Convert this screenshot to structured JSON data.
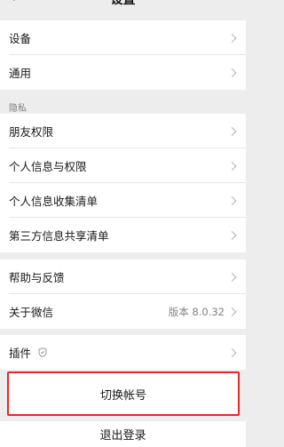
{
  "header": {
    "title": "设置",
    "back_icon": "chevron-left-icon"
  },
  "group1": {
    "items": [
      {
        "label": "设备"
      },
      {
        "label": "通用"
      }
    ]
  },
  "privacy": {
    "section_label": "隐私",
    "items": [
      {
        "label": "朋友权限"
      },
      {
        "label": "个人信息与权限"
      },
      {
        "label": "个人信息收集清单"
      },
      {
        "label": "第三方信息共享清单"
      }
    ]
  },
  "group3": {
    "items": [
      {
        "label": "帮助与反馈"
      },
      {
        "label": "关于微信",
        "value": "版本 8.0.32"
      }
    ]
  },
  "group4": {
    "items": [
      {
        "label": "插件",
        "icon": "shield-icon"
      }
    ]
  },
  "actions": {
    "switch_account": "切换帐号",
    "logout": "退出登录"
  },
  "colors": {
    "highlight_border": "#e8262b",
    "background": "#ededed",
    "chevron": "#b2b2b2"
  }
}
